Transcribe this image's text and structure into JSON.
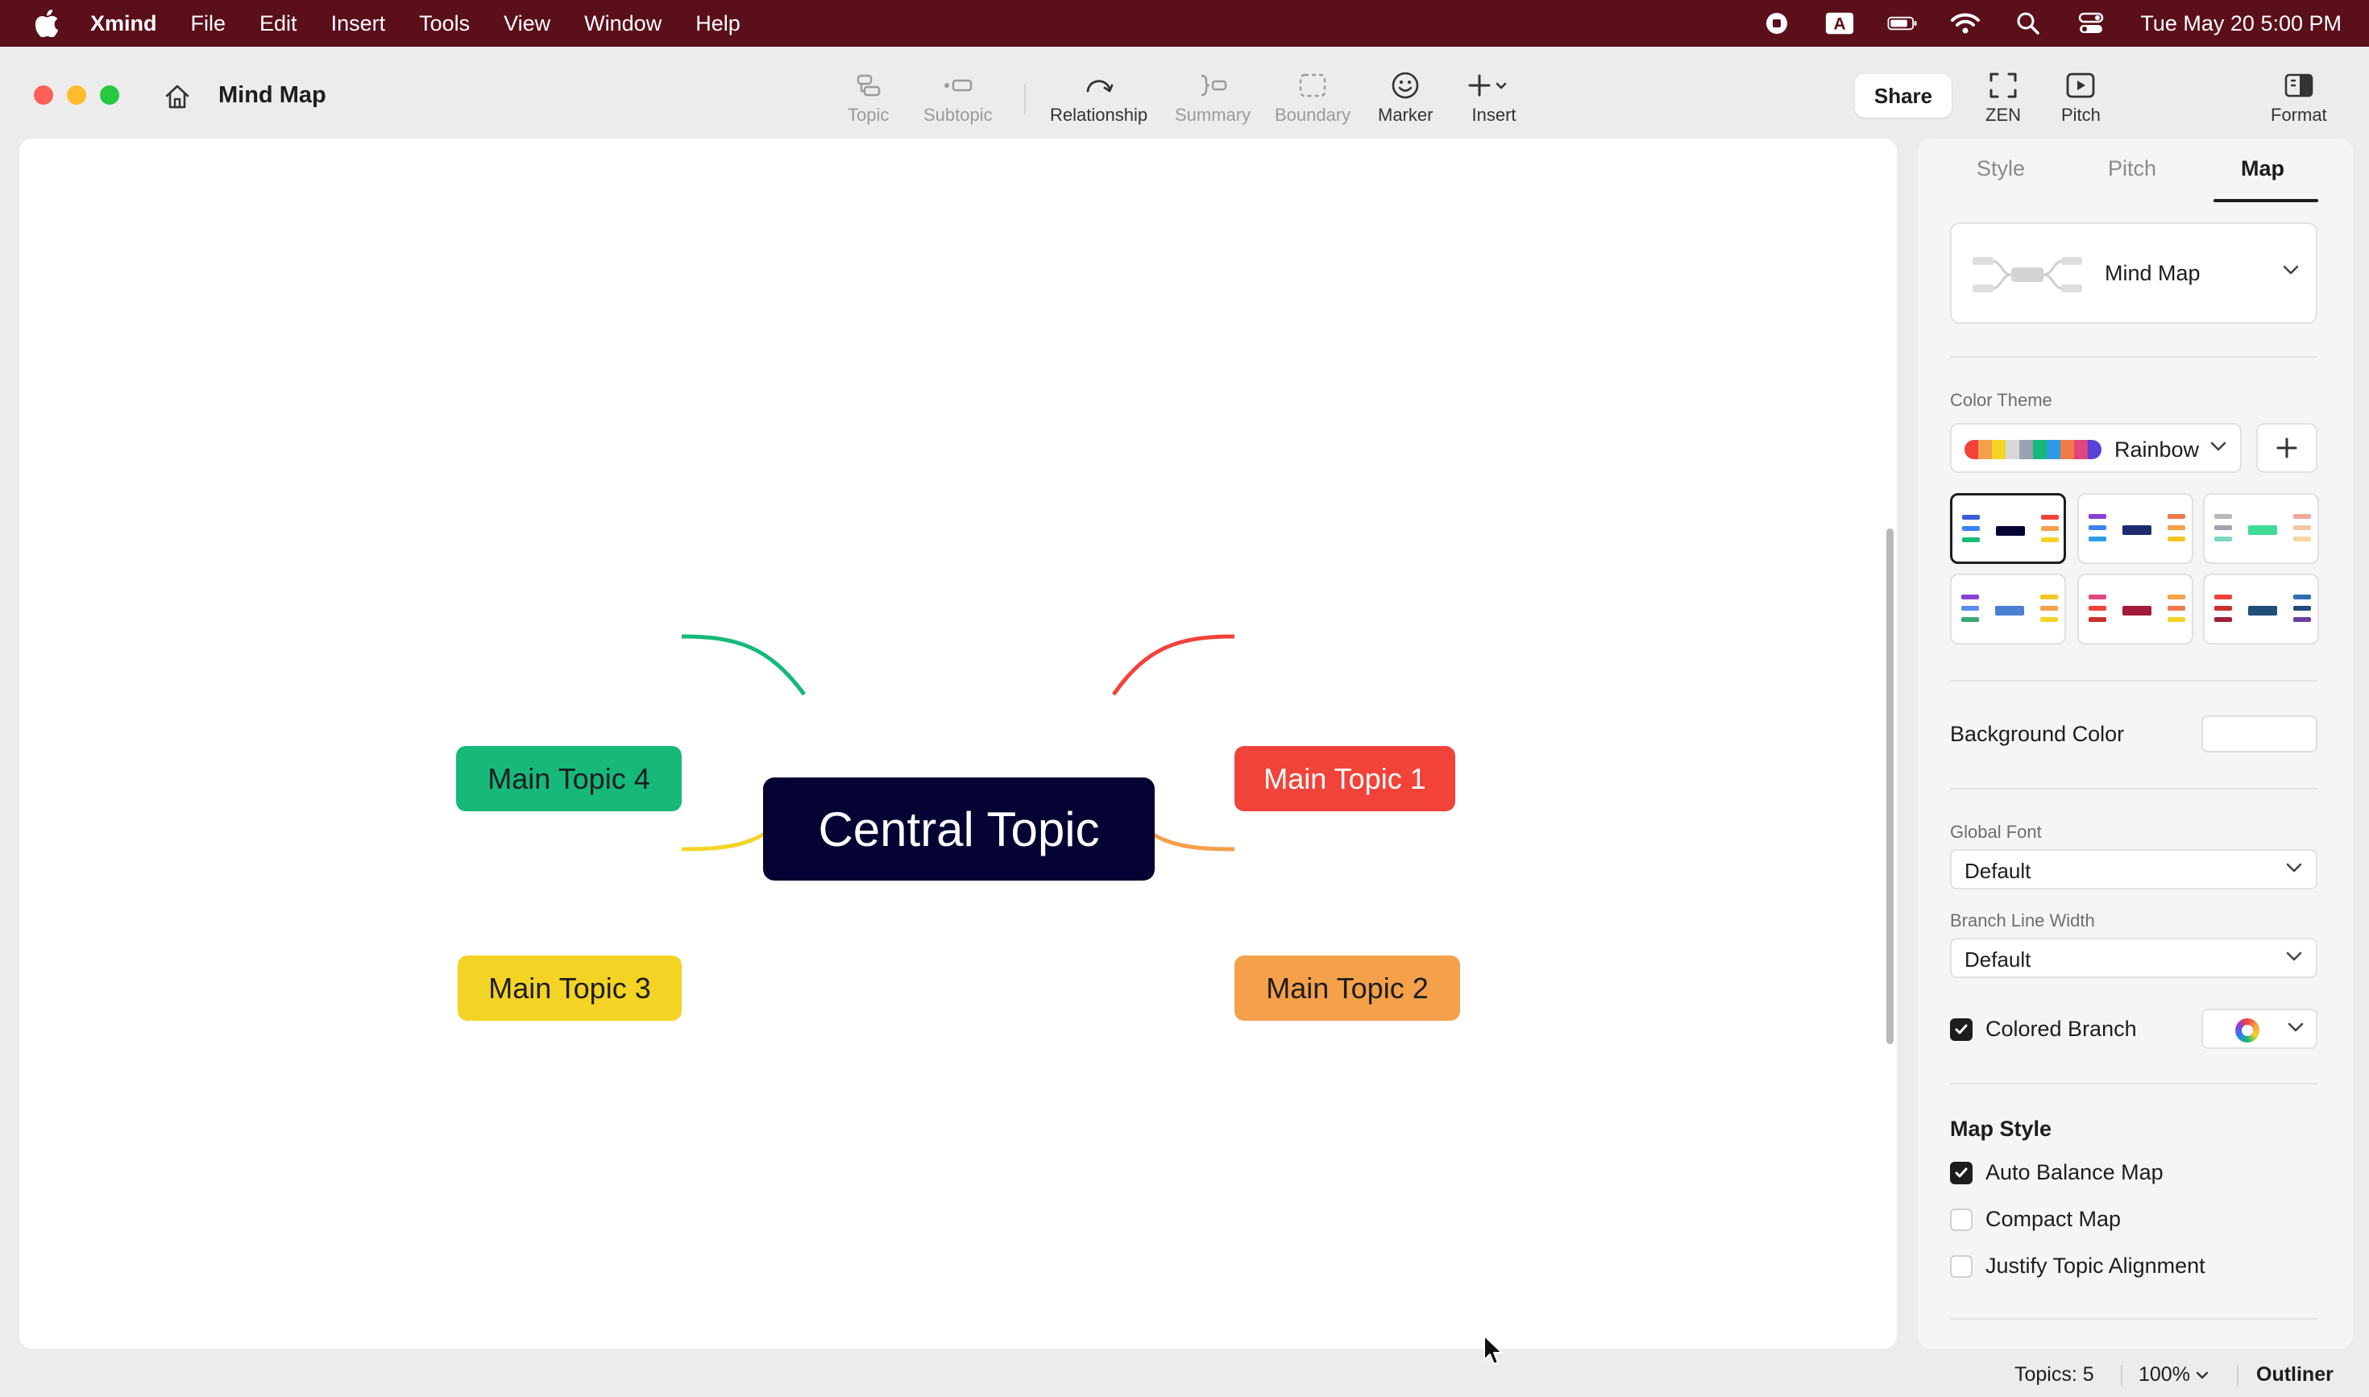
{
  "menubar": {
    "app_name": "Xmind",
    "items": [
      "File",
      "Edit",
      "Insert",
      "Tools",
      "View",
      "Window",
      "Help"
    ],
    "input_badge": "A",
    "clock": "Tue May 20  5:00 PM"
  },
  "window": {
    "title": "Mind Map"
  },
  "toolbar": {
    "topic": "Topic",
    "subtopic": "Subtopic",
    "relationship": "Relationship",
    "summary": "Summary",
    "boundary": "Boundary",
    "marker": "Marker",
    "insert": "Insert",
    "share": "Share",
    "zen": "ZEN",
    "pitch": "Pitch",
    "format": "Format"
  },
  "map": {
    "central_topic": "Central Topic",
    "main_topics": [
      "Main Topic 1",
      "Main Topic 2",
      "Main Topic 3",
      "Main Topic 4"
    ],
    "colors": {
      "central": "#050333",
      "topic1": "#f2433a",
      "topic2": "#f5a04a",
      "topic3": "#f3d425",
      "topic4": "#16b97a"
    }
  },
  "panel": {
    "tabs": [
      "Style",
      "Pitch",
      "Map"
    ],
    "active_tab": "Map",
    "structure": "Mind Map",
    "color_theme_label": "Color Theme",
    "color_theme": "Rainbow",
    "background_color_label": "Background Color",
    "global_font_label": "Global Font",
    "global_font": "Default",
    "branch_line_width_label": "Branch Line Width",
    "branch_line_width": "Default",
    "colored_branch_label": "Colored Branch",
    "colored_branch_checked": true,
    "map_style_heading": "Map Style",
    "auto_balance_label": "Auto Balance Map",
    "auto_balance_checked": true,
    "compact_map_label": "Compact Map",
    "compact_map_checked": false,
    "justify_label": "Justify Topic Alignment",
    "justify_checked": false
  },
  "statusbar": {
    "topics": "Topics: 5",
    "zoom": "100%",
    "outliner": "Outliner"
  }
}
